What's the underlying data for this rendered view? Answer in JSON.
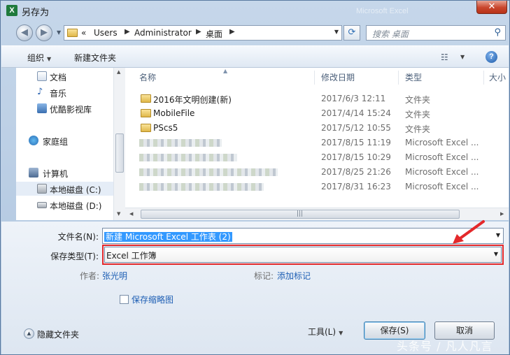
{
  "window": {
    "title": "另存为",
    "app_icon": "X",
    "background_title": "Microsoft Excel",
    "close_label": "✕"
  },
  "address": {
    "prefix": "«",
    "breadcrumbs": [
      "Users",
      "Administrator",
      "桌面"
    ],
    "search_placeholder": "搜索 桌面"
  },
  "toolbar": {
    "organize": "组织",
    "new_folder": "新建文件夹",
    "help": "?"
  },
  "sidebar": {
    "items": [
      {
        "label": "文档",
        "icon": "documents-icon"
      },
      {
        "label": "音乐",
        "icon": "music-icon"
      },
      {
        "label": "优酷影视库",
        "icon": "video-library-icon"
      },
      {
        "label": "家庭组",
        "icon": "homegroup-icon"
      },
      {
        "label": "计算机",
        "icon": "computer-icon"
      },
      {
        "label": "本地磁盘 (C:)",
        "icon": "drive-c-icon"
      },
      {
        "label": "本地磁盘 (D:)",
        "icon": "drive-d-icon"
      }
    ]
  },
  "columns": {
    "name": "名称",
    "modified": "修改日期",
    "type": "类型",
    "size": "大小"
  },
  "files": [
    {
      "name": "2016年文明创建(新)",
      "date": "2017/6/3 12:11",
      "type": "文件夹",
      "blurred": false
    },
    {
      "name": "MobileFile",
      "date": "2017/4/14 15:24",
      "type": "文件夹",
      "blurred": false
    },
    {
      "name": "PScs5",
      "date": "2017/5/12 10:55",
      "type": "文件夹",
      "blurred": false
    },
    {
      "name": "",
      "date": "2017/8/15 11:19",
      "type": "Microsoft Excel ...",
      "blurred": true
    },
    {
      "name": "",
      "date": "2017/8/15 10:29",
      "type": "Microsoft Excel ...",
      "blurred": true
    },
    {
      "name": "",
      "date": "2017/8/25 21:26",
      "type": "Microsoft Excel ...",
      "blurred": true
    },
    {
      "name": "",
      "date": "2017/8/31 16:23",
      "type": "Microsoft Excel ...",
      "blurred": true
    }
  ],
  "form": {
    "filename_label": "文件名(N):",
    "filename_value": "新建 Microsoft Excel 工作表 (2)",
    "filetype_label": "保存类型(T):",
    "filetype_value": "Excel 工作簿",
    "author_label": "作者:",
    "author_value": "张光明",
    "tags_label": "标记:",
    "tags_value": "添加标记",
    "thumbnail_label": "保存缩略图",
    "thumbnail_checked": false
  },
  "footer": {
    "hide_folders": "隐藏文件夹",
    "tools": "工具(L)",
    "save": "保存(S)",
    "cancel": "取消"
  },
  "watermark": "头条号 / 凡人凡言",
  "colors": {
    "highlight_border": "#e4292b",
    "selection": "#3399ff",
    "link": "#1e5fb4"
  }
}
